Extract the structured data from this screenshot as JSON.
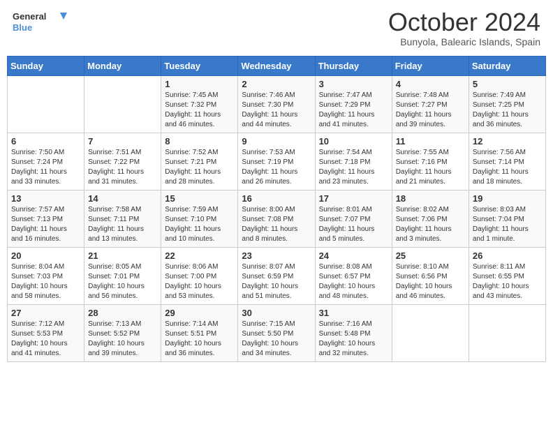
{
  "header": {
    "logo_line1": "General",
    "logo_line2": "Blue",
    "month": "October 2024",
    "location": "Bunyola, Balearic Islands, Spain"
  },
  "days_of_week": [
    "Sunday",
    "Monday",
    "Tuesday",
    "Wednesday",
    "Thursday",
    "Friday",
    "Saturday"
  ],
  "weeks": [
    [
      {
        "day": "",
        "info": ""
      },
      {
        "day": "",
        "info": ""
      },
      {
        "day": "1",
        "info": "Sunrise: 7:45 AM\nSunset: 7:32 PM\nDaylight: 11 hours and 46 minutes."
      },
      {
        "day": "2",
        "info": "Sunrise: 7:46 AM\nSunset: 7:30 PM\nDaylight: 11 hours and 44 minutes."
      },
      {
        "day": "3",
        "info": "Sunrise: 7:47 AM\nSunset: 7:29 PM\nDaylight: 11 hours and 41 minutes."
      },
      {
        "day": "4",
        "info": "Sunrise: 7:48 AM\nSunset: 7:27 PM\nDaylight: 11 hours and 39 minutes."
      },
      {
        "day": "5",
        "info": "Sunrise: 7:49 AM\nSunset: 7:25 PM\nDaylight: 11 hours and 36 minutes."
      }
    ],
    [
      {
        "day": "6",
        "info": "Sunrise: 7:50 AM\nSunset: 7:24 PM\nDaylight: 11 hours and 33 minutes."
      },
      {
        "day": "7",
        "info": "Sunrise: 7:51 AM\nSunset: 7:22 PM\nDaylight: 11 hours and 31 minutes."
      },
      {
        "day": "8",
        "info": "Sunrise: 7:52 AM\nSunset: 7:21 PM\nDaylight: 11 hours and 28 minutes."
      },
      {
        "day": "9",
        "info": "Sunrise: 7:53 AM\nSunset: 7:19 PM\nDaylight: 11 hours and 26 minutes."
      },
      {
        "day": "10",
        "info": "Sunrise: 7:54 AM\nSunset: 7:18 PM\nDaylight: 11 hours and 23 minutes."
      },
      {
        "day": "11",
        "info": "Sunrise: 7:55 AM\nSunset: 7:16 PM\nDaylight: 11 hours and 21 minutes."
      },
      {
        "day": "12",
        "info": "Sunrise: 7:56 AM\nSunset: 7:14 PM\nDaylight: 11 hours and 18 minutes."
      }
    ],
    [
      {
        "day": "13",
        "info": "Sunrise: 7:57 AM\nSunset: 7:13 PM\nDaylight: 11 hours and 16 minutes."
      },
      {
        "day": "14",
        "info": "Sunrise: 7:58 AM\nSunset: 7:11 PM\nDaylight: 11 hours and 13 minutes."
      },
      {
        "day": "15",
        "info": "Sunrise: 7:59 AM\nSunset: 7:10 PM\nDaylight: 11 hours and 10 minutes."
      },
      {
        "day": "16",
        "info": "Sunrise: 8:00 AM\nSunset: 7:08 PM\nDaylight: 11 hours and 8 minutes."
      },
      {
        "day": "17",
        "info": "Sunrise: 8:01 AM\nSunset: 7:07 PM\nDaylight: 11 hours and 5 minutes."
      },
      {
        "day": "18",
        "info": "Sunrise: 8:02 AM\nSunset: 7:06 PM\nDaylight: 11 hours and 3 minutes."
      },
      {
        "day": "19",
        "info": "Sunrise: 8:03 AM\nSunset: 7:04 PM\nDaylight: 11 hours and 1 minute."
      }
    ],
    [
      {
        "day": "20",
        "info": "Sunrise: 8:04 AM\nSunset: 7:03 PM\nDaylight: 10 hours and 58 minutes."
      },
      {
        "day": "21",
        "info": "Sunrise: 8:05 AM\nSunset: 7:01 PM\nDaylight: 10 hours and 56 minutes."
      },
      {
        "day": "22",
        "info": "Sunrise: 8:06 AM\nSunset: 7:00 PM\nDaylight: 10 hours and 53 minutes."
      },
      {
        "day": "23",
        "info": "Sunrise: 8:07 AM\nSunset: 6:59 PM\nDaylight: 10 hours and 51 minutes."
      },
      {
        "day": "24",
        "info": "Sunrise: 8:08 AM\nSunset: 6:57 PM\nDaylight: 10 hours and 48 minutes."
      },
      {
        "day": "25",
        "info": "Sunrise: 8:10 AM\nSunset: 6:56 PM\nDaylight: 10 hours and 46 minutes."
      },
      {
        "day": "26",
        "info": "Sunrise: 8:11 AM\nSunset: 6:55 PM\nDaylight: 10 hours and 43 minutes."
      }
    ],
    [
      {
        "day": "27",
        "info": "Sunrise: 7:12 AM\nSunset: 5:53 PM\nDaylight: 10 hours and 41 minutes."
      },
      {
        "day": "28",
        "info": "Sunrise: 7:13 AM\nSunset: 5:52 PM\nDaylight: 10 hours and 39 minutes."
      },
      {
        "day": "29",
        "info": "Sunrise: 7:14 AM\nSunset: 5:51 PM\nDaylight: 10 hours and 36 minutes."
      },
      {
        "day": "30",
        "info": "Sunrise: 7:15 AM\nSunset: 5:50 PM\nDaylight: 10 hours and 34 minutes."
      },
      {
        "day": "31",
        "info": "Sunrise: 7:16 AM\nSunset: 5:48 PM\nDaylight: 10 hours and 32 minutes."
      },
      {
        "day": "",
        "info": ""
      },
      {
        "day": "",
        "info": ""
      }
    ]
  ]
}
